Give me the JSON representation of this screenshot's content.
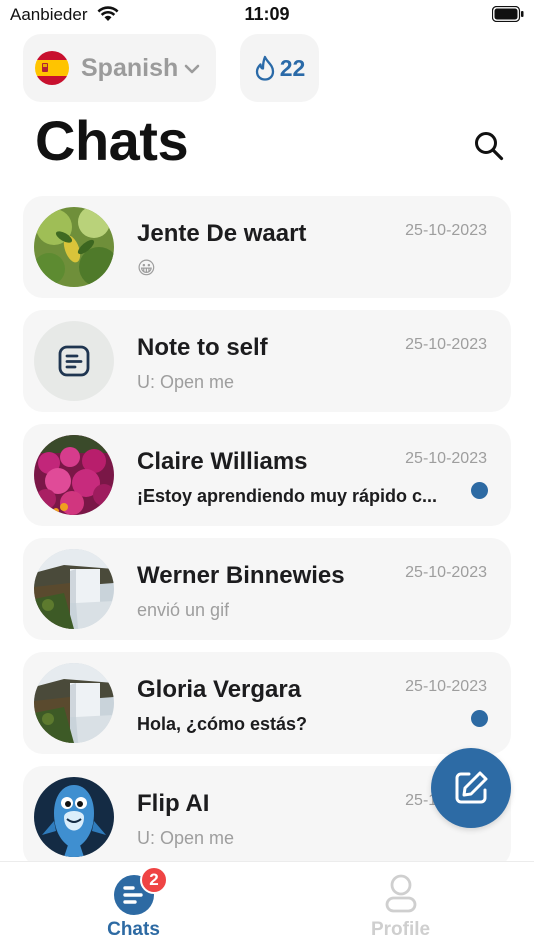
{
  "status_bar": {
    "carrier": "Aanbieder",
    "time": "11:09"
  },
  "header": {
    "language": "Spanish",
    "streak_count": "22",
    "title": "Chats"
  },
  "chats": [
    {
      "name": "Jente De waart",
      "date": "25-10-2023",
      "preview": "😀",
      "unread": false,
      "avatar": "leaves-photo"
    },
    {
      "name": "Note to self",
      "date": "25-10-2023",
      "preview": "U: Open me",
      "unread": false,
      "avatar": "note-icon"
    },
    {
      "name": "Claire Williams",
      "date": "25-10-2023",
      "preview": "¡Estoy aprendiendo muy rápido c...",
      "unread": true,
      "avatar": "flowers-photo"
    },
    {
      "name": "Werner Binnewies",
      "date": "25-10-2023",
      "preview": "envió un gif",
      "unread": false,
      "avatar": "waterfall-photo"
    },
    {
      "name": "Gloria Vergara",
      "date": "25-10-2023",
      "preview": "Hola, ¿cómo estás?",
      "unread": true,
      "avatar": "waterfall-photo"
    },
    {
      "name": "Flip AI",
      "date": "25-10-2023",
      "preview": "U: Open me",
      "unread": false,
      "avatar": "dolphin-mascot"
    }
  ],
  "tabs": {
    "chats_label": "Chats",
    "chats_badge": "2",
    "profile_label": "Profile"
  },
  "colors": {
    "accent": "#2d6aa3",
    "badge": "#ef4444",
    "card_bg": "#f6f6f6"
  }
}
